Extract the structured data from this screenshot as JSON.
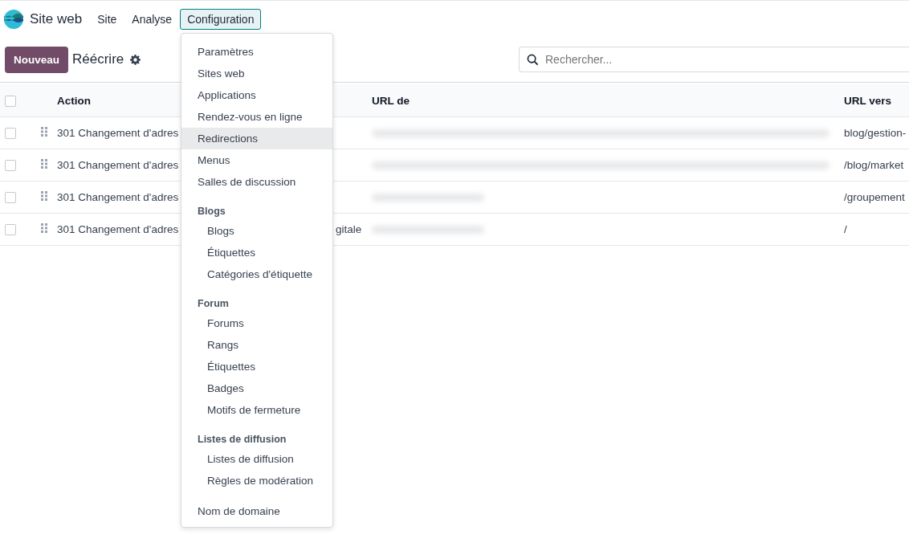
{
  "app": {
    "title": "Site web"
  },
  "nav": [
    {
      "label": "Site",
      "selected": false
    },
    {
      "label": "Analyse",
      "selected": false
    },
    {
      "label": "Configuration",
      "selected": true
    }
  ],
  "toolbar": {
    "new_button": "Nouveau",
    "title": "Réécrire"
  },
  "search": {
    "placeholder": "Rechercher..."
  },
  "table": {
    "select_all": {
      "checked": false
    },
    "columns": [
      "Action",
      "URL de",
      "URL vers"
    ],
    "rows": [
      {
        "checked": false,
        "action": "301 Changement d'adres",
        "column_2": "",
        "url_from": {
          "kind": "redacted-long"
        },
        "url_to": "blog/gestion-"
      },
      {
        "checked": false,
        "action": "301 Changement d'adres",
        "column_2": "",
        "url_from": {
          "kind": "redacted-long"
        },
        "url_to": "/blog/market"
      },
      {
        "checked": false,
        "action": "301 Changement d'adres",
        "column_2": "",
        "url_from": {
          "kind": "redacted-short"
        },
        "url_to": "/groupement"
      },
      {
        "checked": false,
        "action": "301 Changement d'adres",
        "column_2": "gitale",
        "url_from": {
          "kind": "redacted-short"
        },
        "url_to": "/"
      }
    ]
  },
  "menu": {
    "items": [
      {
        "kind": "item",
        "label": "Paramètres",
        "selected": false
      },
      {
        "kind": "item",
        "label": "Sites web",
        "selected": false
      },
      {
        "kind": "item",
        "label": "Applications",
        "selected": false
      },
      {
        "kind": "item",
        "label": "Rendez-vous en ligne",
        "selected": false
      },
      {
        "kind": "item",
        "label": "Redirections",
        "selected": true
      },
      {
        "kind": "item",
        "label": "Menus",
        "selected": false
      },
      {
        "kind": "item",
        "label": "Salles de discussion",
        "selected": false
      },
      {
        "kind": "header",
        "label": "Blogs"
      },
      {
        "kind": "subitem",
        "label": "Blogs",
        "selected": false
      },
      {
        "kind": "subitem",
        "label": "Étiquettes",
        "selected": false
      },
      {
        "kind": "subitem",
        "label": "Catégories d'étiquette",
        "selected": false
      },
      {
        "kind": "header",
        "label": "Forum"
      },
      {
        "kind": "subitem",
        "label": "Forums",
        "selected": false
      },
      {
        "kind": "subitem",
        "label": "Rangs",
        "selected": false
      },
      {
        "kind": "subitem",
        "label": "Étiquettes",
        "selected": false
      },
      {
        "kind": "subitem",
        "label": "Badges",
        "selected": false
      },
      {
        "kind": "subitem",
        "label": "Motifs de fermeture",
        "selected": false
      },
      {
        "kind": "header",
        "label": "Listes de diffusion"
      },
      {
        "kind": "subitem",
        "label": "Listes de diffusion",
        "selected": false
      },
      {
        "kind": "subitem",
        "label": "Règles de modération",
        "selected": false
      },
      {
        "kind": "gap-item",
        "label": "Nom de domaine",
        "selected": false
      }
    ]
  }
}
